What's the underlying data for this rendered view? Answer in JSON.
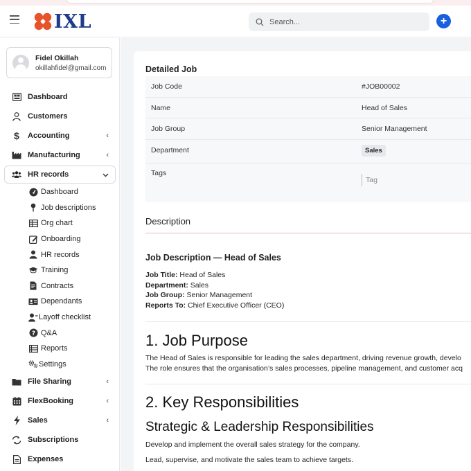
{
  "header": {
    "logo_text": "IXL",
    "search_placeholder": "Search...",
    "add_label": "+"
  },
  "colors": {
    "brand_orange": "#e8542a",
    "brand_navy": "#1f3b8c",
    "primary_blue": "#1a5fe0"
  },
  "user": {
    "name": "Fidel Okillah",
    "email": "okillahfidel@gmail.com"
  },
  "nav": {
    "items": [
      {
        "label": "Dashboard",
        "icon": "dashboard-icon",
        "chevron": ""
      },
      {
        "label": "Customers",
        "icon": "person-icon",
        "chevron": ""
      },
      {
        "label": "Accounting",
        "icon": "dollar-icon",
        "chevron": "‹"
      },
      {
        "label": "Manufacturing",
        "icon": "factory-icon",
        "chevron": "‹"
      },
      {
        "label": "HR records",
        "icon": "users-icon",
        "chevron": "⌄"
      }
    ],
    "hr_sub": [
      {
        "label": "Dashboard",
        "icon": "tachometer-icon"
      },
      {
        "label": "Job descriptions",
        "icon": "pin-icon"
      },
      {
        "label": "Org chart",
        "icon": "table-icon"
      },
      {
        "label": "Onboarding",
        "icon": "edit-icon"
      },
      {
        "label": "HR records",
        "icon": "user-icon"
      },
      {
        "label": "Training",
        "icon": "graduation-cap-icon"
      },
      {
        "label": "Contracts",
        "icon": "file-contract-icon"
      },
      {
        "label": "Dependants",
        "icon": "id-card-icon"
      },
      {
        "label": "Layoff checklist",
        "icon": "user-remove-icon"
      },
      {
        "label": "Q&A",
        "icon": "question-icon"
      },
      {
        "label": "Reports",
        "icon": "list-icon"
      },
      {
        "label": "Settings",
        "icon": "cogs-icon"
      }
    ],
    "bottom_items": [
      {
        "label": "File Sharing",
        "icon": "folder-icon",
        "chevron": "‹"
      },
      {
        "label": "FlexBooking",
        "icon": "calendar-icon",
        "chevron": "‹"
      },
      {
        "label": "Sales",
        "icon": "bolt-icon",
        "chevron": "‹"
      },
      {
        "label": "Subscriptions",
        "icon": "refresh-icon",
        "chevron": ""
      },
      {
        "label": "Expenses",
        "icon": "document-icon",
        "chevron": ""
      }
    ]
  },
  "job": {
    "section_title": "Detailed Job",
    "rows": [
      {
        "key": "Job Code",
        "value": "#JOB00002"
      },
      {
        "key": "Name",
        "value": "Head of Sales"
      },
      {
        "key": "Job Group",
        "value": "Senior Management"
      }
    ],
    "department_label": "Department",
    "department_value": "Sales",
    "tags_label": "Tags",
    "tags_placeholder": "Tag"
  },
  "description": {
    "heading": "Description",
    "title": "Job Description — Head of Sales",
    "meta": [
      {
        "label": "Job Title:",
        "value": " Head of Sales"
      },
      {
        "label": "Department:",
        "value": " Sales"
      },
      {
        "label": "Job Group:",
        "value": " Senior Management"
      },
      {
        "label": "Reports To:",
        "value": " Chief Executive Officer (CEO)"
      }
    ],
    "h_purpose": "1. Job Purpose",
    "purpose_1": "The Head of Sales is responsible for leading the sales department, driving revenue growth, develo",
    "purpose_2": "The role ensures that the organisation’s sales processes, pipeline management, and customer acq",
    "h_resp": "2. Key Responsibilities",
    "h_strategic": "Strategic & Leadership Responsibilities",
    "resp_1": "Develop and implement the overall sales strategy for the company.",
    "resp_2": "Lead, supervise, and motivate the sales team to achieve targets."
  }
}
